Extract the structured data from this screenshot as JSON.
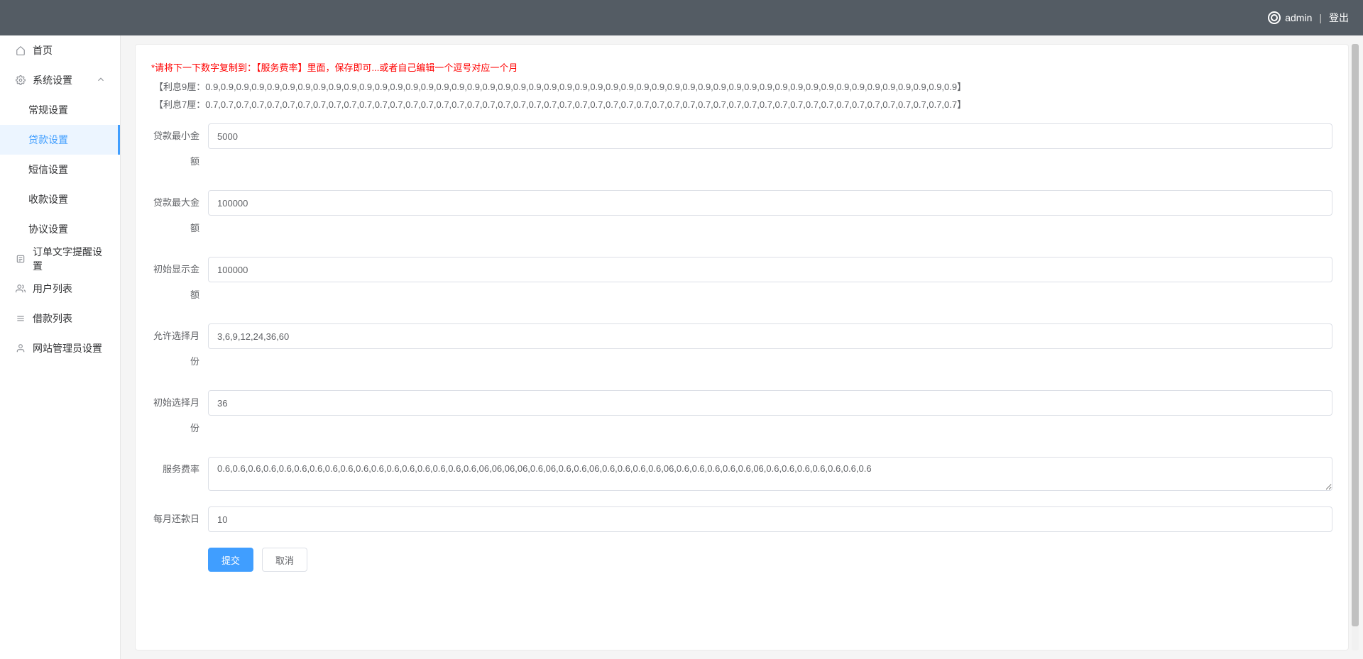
{
  "header": {
    "username": "admin",
    "separator": "|",
    "logout": "登出"
  },
  "sidebar": {
    "home": "首页",
    "system_settings": "系统设置",
    "system_items": {
      "general": "常规设置",
      "loan": "贷款设置",
      "sms": "短信设置",
      "payment": "收款设置",
      "agreement": "协议设置"
    },
    "order_reminder": "订单文字提醒设置",
    "user_list": "用户列表",
    "loan_list": "借款列表",
    "admin_settings": "网站管理员设置"
  },
  "hints": {
    "red": "*请将下一下数字复制到：【服务费率】里面，保存即可...或者自己编辑一个逗号对应一个月",
    "interest9": "【利息9厘：0.9,0.9,0.9,0.9,0.9,0.9,0.9,0.9,0.9,0.9,0.9,0.9,0.9,0.9,0.9,0.9,0.9,0.9,0.9,0.9,0.9,0.9,0.9,0.9,0.9,0.9,0.9,0.9,0.9,0.9,0.9,0.9,0.9,0.9,0.9,0.9,0.9,0.9,0.9,0.9,0.9,0.9,0.9,0.9,0.9,0.9,0.9,0.9,0.9】",
    "interest7": "【利息7厘：0.7,0.7,0.7,0.7,0.7,0.7,0.7,0.7,0.7,0.7,0.7,0.7,0.7,0.7,0.7,0.7,0.7,0.7,0.7,0.7,0.7,0.7,0.7,0.7,0.7,0.7,0.7,0.7,0.7,0.7,0.7,0.7,0.7,0.7,0.7,0.7,0.7,0.7,0.7,0.7,0.7,0.7,0.7,0.7,0.7,0.7,0.7,0.7,0.7】"
  },
  "form": {
    "min_amount_label": "贷款最小金额",
    "min_amount_value": "5000",
    "max_amount_label": "贷款最大金额",
    "max_amount_value": "100000",
    "init_display_label": "初始显示金额",
    "init_display_value": "100000",
    "allow_months_label": "允许选择月份",
    "allow_months_value": "3,6,9,12,24,36,60",
    "init_months_label": "初始选择月份",
    "init_months_value": "36",
    "service_rate_label": "服务费率",
    "service_rate_value": "0.6,0.6,0.6,0.6,0.6,0.6,0.6,0.6,0.6,0.6,0.6,0.6,0.6,0.6,0.6,0.6,0.6,06,06,06,06,0.6,06,0.6,0.6,06,0.6,0.6,0.6,0.6,06,0.6,0.6,0.6,0.6,0.6,06,0.6,0.6,0.6,0.6,0.6,0.6,0.6",
    "repay_day_label": "每月还款日",
    "repay_day_value": "10",
    "submit": "提交",
    "cancel": "取消"
  }
}
